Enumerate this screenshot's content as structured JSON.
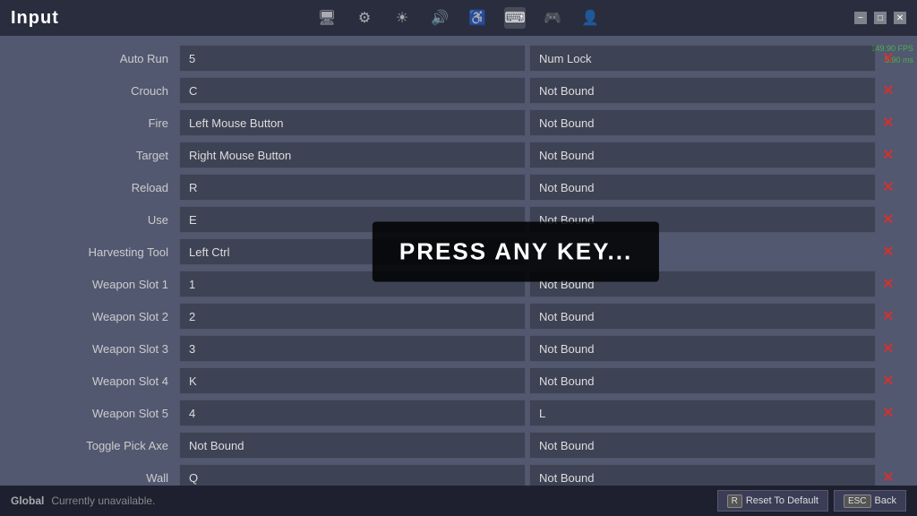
{
  "window": {
    "title": "Input",
    "fps": "149.90 FPS",
    "ms": "5.90 ms"
  },
  "nav": {
    "icons": [
      {
        "name": "monitor-icon",
        "symbol": "🖥",
        "active": false
      },
      {
        "name": "gear-icon",
        "symbol": "⚙",
        "active": false
      },
      {
        "name": "brightness-icon",
        "symbol": "☀",
        "active": false
      },
      {
        "name": "audio-icon",
        "symbol": "🔊",
        "active": false
      },
      {
        "name": "accessibility-icon",
        "symbol": "♿",
        "active": false
      },
      {
        "name": "input-icon",
        "symbol": "⌨",
        "active": true
      },
      {
        "name": "controller-icon",
        "symbol": "🎮",
        "active": false
      },
      {
        "name": "account-icon",
        "symbol": "👤",
        "active": false
      }
    ]
  },
  "bindings": [
    {
      "label": "Auto Run",
      "primary": "5",
      "secondary": "Num Lock",
      "clearable": true
    },
    {
      "label": "Crouch",
      "primary": "C",
      "secondary": "Not Bound",
      "clearable": true
    },
    {
      "label": "Fire",
      "primary": "Left Mouse Button",
      "secondary": "Not Bound",
      "clearable": true
    },
    {
      "label": "Target",
      "primary": "Right Mouse Button",
      "secondary": "Not Bound",
      "clearable": true
    },
    {
      "label": "Reload",
      "primary": "R",
      "secondary": "Not Bound",
      "clearable": true
    },
    {
      "label": "Use",
      "primary": "E",
      "secondary": "Not Bound",
      "clearable": true
    },
    {
      "label": "Harvesting Tool",
      "primary": "Left Ctrl",
      "secondary": "PRESS ANY KEY...",
      "clearable": true,
      "pressAnyKey": true
    },
    {
      "label": "Weapon Slot 1",
      "primary": "1",
      "secondary": "Not Bound",
      "clearable": true
    },
    {
      "label": "Weapon Slot 2",
      "primary": "2",
      "secondary": "Not Bound",
      "clearable": true
    },
    {
      "label": "Weapon Slot 3",
      "primary": "3",
      "secondary": "Not Bound",
      "clearable": true
    },
    {
      "label": "Weapon Slot 4",
      "primary": "K",
      "secondary": "Not Bound",
      "clearable": true
    },
    {
      "label": "Weapon Slot 5",
      "primary": "4",
      "secondary": "L",
      "clearable": true
    },
    {
      "label": "Toggle Pick Axe",
      "primary": "Not Bound",
      "secondary": "Not Bound",
      "clearable": false
    },
    {
      "label": "Wall",
      "primary": "Q",
      "secondary": "Not Bound",
      "clearable": true
    }
  ],
  "statusBar": {
    "label": "Global",
    "message": "Currently unavailable.",
    "resetButton": "Reset To Default",
    "resetKey": "R",
    "backButton": "Back",
    "backKey": "ESC"
  },
  "overlay": {
    "text": "PRESS ANY KEY..."
  }
}
